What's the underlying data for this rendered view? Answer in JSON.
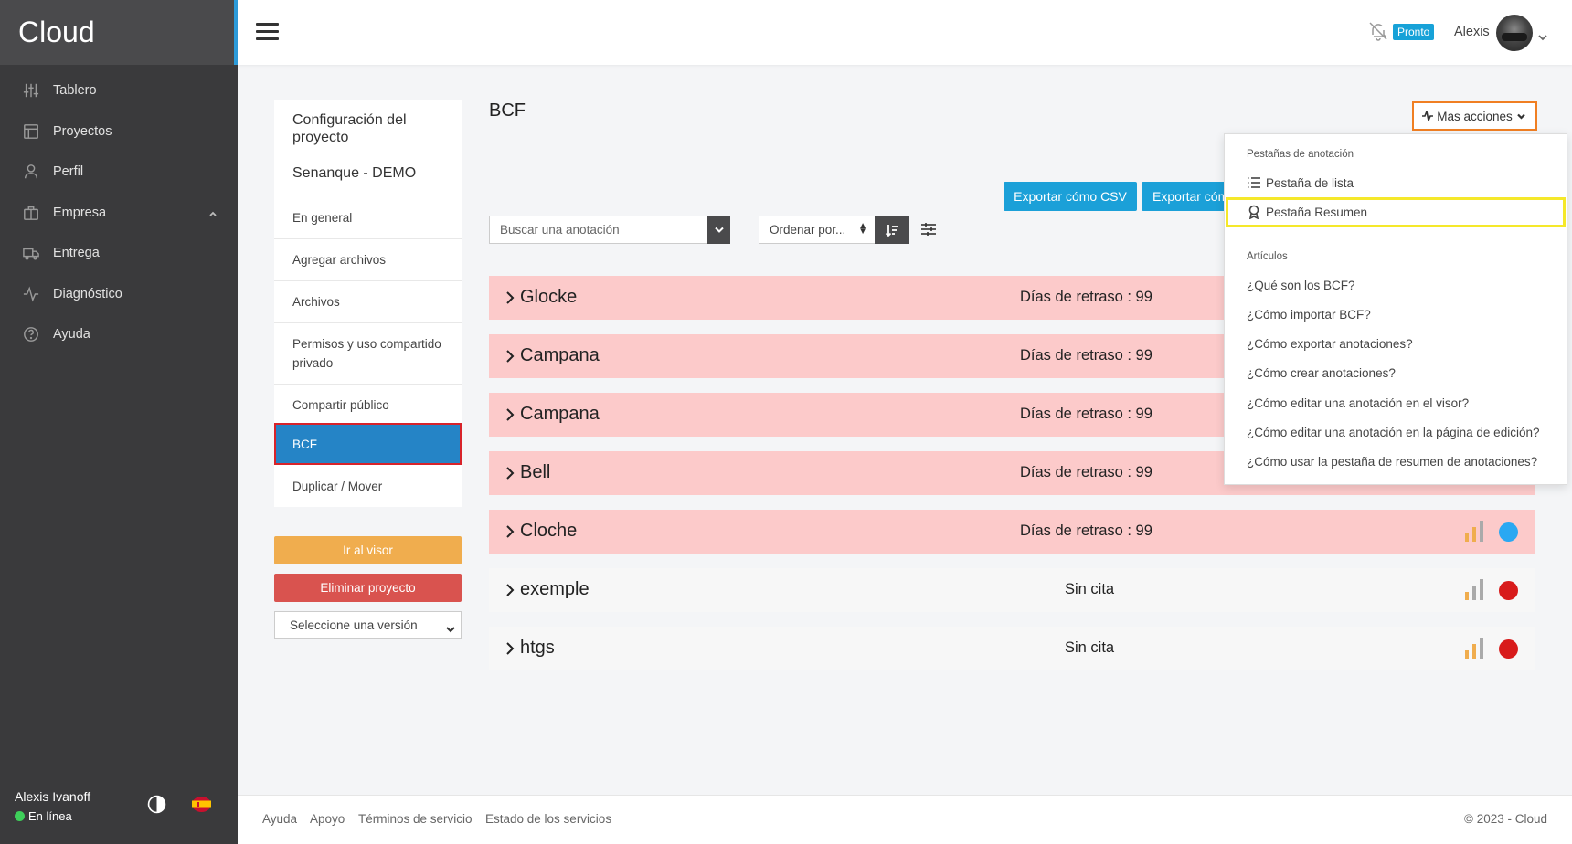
{
  "app": {
    "brand": "Cloud"
  },
  "sidebar": {
    "items": [
      {
        "label": "Tablero",
        "icon": "sliders-icon"
      },
      {
        "label": "Proyectos",
        "icon": "grid-icon"
      },
      {
        "label": "Perfil",
        "icon": "user-icon"
      },
      {
        "label": "Empresa",
        "icon": "briefcase-icon"
      },
      {
        "label": "Entrega",
        "icon": "truck-icon"
      },
      {
        "label": "Diagnóstico",
        "icon": "activity-icon"
      },
      {
        "label": "Ayuda",
        "icon": "help-circle-icon"
      }
    ],
    "user_name": "Alexis Ivanoff",
    "status": "En línea"
  },
  "header": {
    "badge": "Pronto",
    "user_name": "Alexis"
  },
  "project_menu": {
    "title": "Configuración del proyecto",
    "project_name": "Senanque - DEMO",
    "items": [
      {
        "label": "En general"
      },
      {
        "label": "Agregar archivos"
      },
      {
        "label": "Archivos"
      },
      {
        "label": "Permisos y uso compartido privado"
      },
      {
        "label": "Compartir público"
      },
      {
        "label": "BCF"
      },
      {
        "label": "Duplicar / Mover"
      }
    ],
    "go_viewer": "Ir al visor",
    "delete_project": "Eliminar proyecto",
    "version_select": "Seleccione una versión"
  },
  "main": {
    "title": "BCF",
    "more_actions": "Mas acciones",
    "export_csv": "Exportar cómo CSV",
    "export_partial": "Exportar cómo",
    "search_placeholder": "Buscar una anotación",
    "order_by": "Ordenar por...",
    "rows": [
      {
        "name": "Glocke",
        "status": "Días de retraso : 99",
        "late": true,
        "dot": "#2aa8f2"
      },
      {
        "name": "Campana",
        "status": "Días de retraso : 99",
        "late": true,
        "dot": "#2aa8f2"
      },
      {
        "name": "Campana",
        "status": "Días de retraso : 99",
        "late": true,
        "dot": "#2aa8f2"
      },
      {
        "name": "Bell",
        "status": "Días de retraso : 99",
        "late": true,
        "dot": "#2aa8f2"
      },
      {
        "name": "Cloche",
        "status": "Días de retraso : 99",
        "late": true,
        "dot": "#2aa8f2"
      },
      {
        "name": "exemple",
        "status": "Sin cita",
        "late": false,
        "dot": "#d81b1b"
      },
      {
        "name": "htgs",
        "status": "Sin cita",
        "late": false,
        "dot": "#d81b1b"
      }
    ]
  },
  "dropdown": {
    "section_tabs": "Pestañas de anotación",
    "tab_list": "Pestaña de lista",
    "tab_summary": "Pestaña Resumen",
    "section_articles": "Artículos",
    "articles": [
      "¿Qué son los BCF?",
      "¿Cómo importar BCF?",
      "¿Cómo exportar anotaciones?",
      "¿Cómo crear anotaciones?",
      "¿Cómo editar una anotación en el visor?",
      "¿Cómo editar una anotación en la página de edición?",
      "¿Cómo usar la pestaña de resumen de anotaciones?"
    ]
  },
  "footer": {
    "links": [
      "Ayuda",
      "Apoyo",
      "Términos de servicio",
      "Estado de los servicios"
    ],
    "copyright": "© 2023 - Cloud"
  },
  "colors": {
    "sidebar_bg": "#3a3a3c",
    "accent_blue": "#1ba0d8",
    "row_late_bg": "#fccaca",
    "active_item": "#2584c6",
    "highlight_yellow": "#f5e82a",
    "highlight_orange": "#f07f23"
  }
}
